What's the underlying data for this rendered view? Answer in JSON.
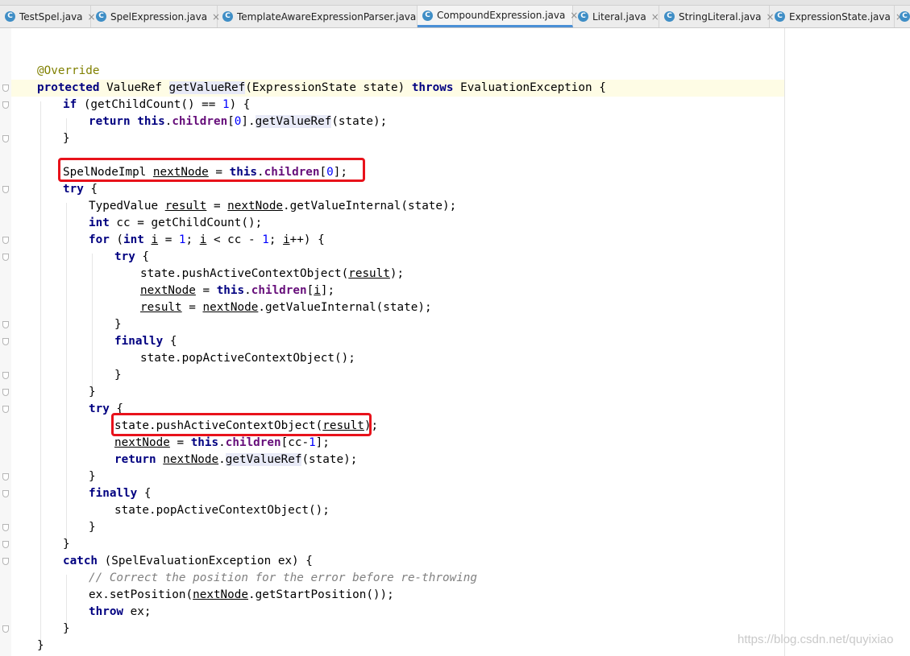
{
  "tabs": [
    {
      "label": "TestSpel.java",
      "active": false
    },
    {
      "label": "SpelExpression.java",
      "active": false
    },
    {
      "label": "TemplateAwareExpressionParser.java",
      "active": false
    },
    {
      "label": "CompoundExpression.java",
      "active": true
    },
    {
      "label": "Literal.java",
      "active": false
    },
    {
      "label": "StringLiteral.java",
      "active": false
    },
    {
      "label": "ExpressionState.java",
      "active": false
    }
  ],
  "tab_icon_letter": "C",
  "tab_close_glyph": "×",
  "code": {
    "t01": "@Override",
    "t02": "protected",
    "t03": " ValueRef ",
    "t04": "getValueRef",
    "t05": "(ExpressionState state) ",
    "t06": "throws",
    "t07": " EvaluationException {",
    "t08": "if",
    "t09": " (getChildCount() == ",
    "t10": "1",
    "t11": ") {",
    "t12": "return",
    "t13": " ",
    "t14": "this",
    "t15": ".",
    "t16": "children",
    "t17": "[",
    "t18": "0",
    "t19": "].",
    "t20": "getValueRef",
    "t21": "(state);",
    "t22": "}",
    "t23": "SpelNodeImpl ",
    "t24": "nextNode",
    "t25": " = ",
    "t26": "this",
    "t27": ".",
    "t28": "children",
    "t29": "[",
    "t30": "0",
    "t31": "];",
    "t32": "try",
    "t33": " {",
    "t34": "TypedValue ",
    "t35": "result",
    "t36": " = ",
    "t37": "nextNode",
    "t38": ".getValueInternal(state);",
    "t39": "int",
    "t40": " cc = getChildCount();",
    "t41": "for",
    "t42": " (",
    "t43": "int",
    "t44": " ",
    "t45": "i",
    "t46": " = ",
    "t47": "1",
    "t48": "; ",
    "t49": "i",
    "t50": " < cc - ",
    "t51": "1",
    "t52": "; ",
    "t53": "i",
    "t54": "++) {",
    "t55": "try",
    "t56": " {",
    "t57": "state.pushActiveContextObject(",
    "t58": "result",
    "t59": ");",
    "t60": "nextNode",
    "t61": " = ",
    "t62": "this",
    "t63": ".",
    "t64": "children",
    "t65": "[",
    "t66": "i",
    "t67": "];",
    "t68": "result",
    "t69": " = ",
    "t70": "nextNode",
    "t71": ".getValueInternal(state);",
    "t72": "}",
    "t73": "finally",
    "t74": " {",
    "t75": "state.popActiveContextObject();",
    "t76": "}",
    "t77": "}",
    "t78": "try",
    "t79": " {",
    "t80": "state.pushActiveContextObject(",
    "t81": "result",
    "t82": ");",
    "t83": "nextNode",
    "t84": " = ",
    "t85": "this",
    "t86": ".",
    "t87": "children",
    "t88": "[cc-",
    "t89": "1",
    "t90": "];",
    "t91": "return",
    "t92": " ",
    "t93": "nextNode",
    "t94": ".",
    "t95": "getValueRef",
    "t96": "(state);",
    "t97": "}",
    "t98": "finally",
    "t99": " {",
    "t100": "state.popActiveContextObject();",
    "t101": "}",
    "t102": "}",
    "t103": "catch",
    "t104": " (SpelEvaluationException ex) {",
    "t105": "// Correct the position for the error before re-throwing",
    "t106": "ex.setPosition(",
    "t107": "nextNode",
    "t108": ".getStartPosition());",
    "t109": "throw",
    "t110": " ex;",
    "t111": "}",
    "t112": "}"
  },
  "watermark": "https://blog.csdn.net/quyixiao",
  "colors": {
    "keyword": "#000080",
    "field": "#660e7a",
    "number": "#0000ff",
    "annotation": "#808000",
    "comment": "#808080",
    "highlight_box": "#e8121b",
    "active_tab_underline": "#4a8fd6"
  }
}
